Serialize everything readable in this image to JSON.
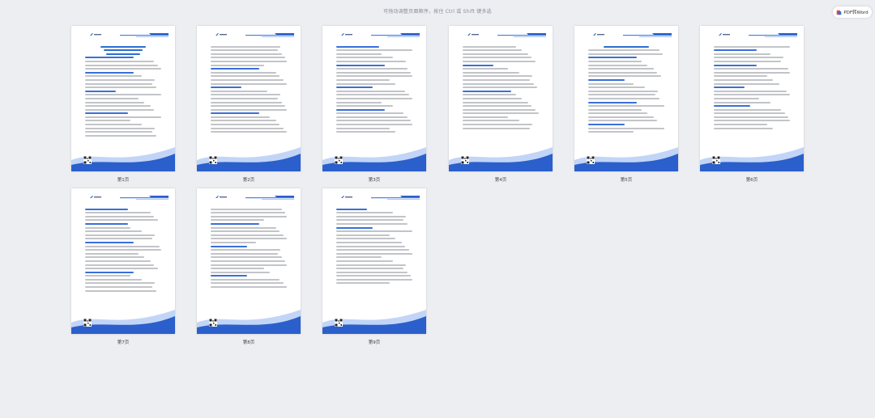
{
  "hint_text": "可拖动调整页面顺序，按住 Ctrl 或 Shift 键多选",
  "convert_button": {
    "label": "PDF转Word",
    "icon": "pdf-word-icon"
  },
  "colors": {
    "accent": "#2a6fd0",
    "wave_dark": "#2b5fcb",
    "wave_light": "#8fb3f0"
  },
  "pages": [
    {
      "label": "第1页"
    },
    {
      "label": "第2页"
    },
    {
      "label": "第3页"
    },
    {
      "label": "第4页"
    },
    {
      "label": "第5页"
    },
    {
      "label": "第6页"
    },
    {
      "label": "第7页"
    },
    {
      "label": "第8页"
    },
    {
      "label": "第9页"
    }
  ]
}
